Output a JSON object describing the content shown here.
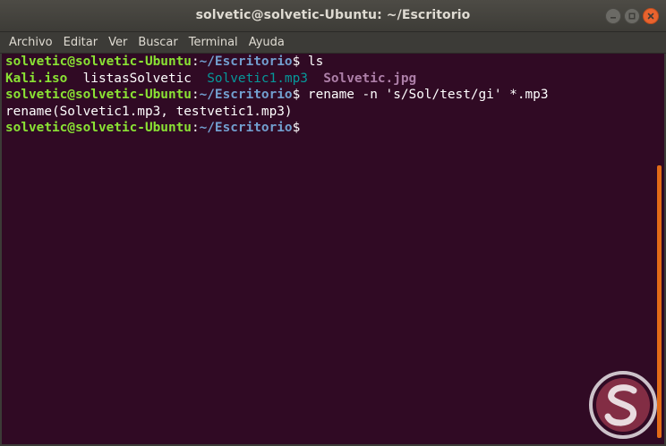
{
  "window": {
    "title": "solvetic@solvetic-Ubuntu: ~/Escritorio",
    "buttons": {
      "minimize_icon": "minimize-icon",
      "maximize_icon": "maximize-icon",
      "close_icon": "close-icon"
    },
    "accent": "#e26b17",
    "close_color": "#e9632e"
  },
  "menubar": {
    "items": [
      "Archivo",
      "Editar",
      "Ver",
      "Buscar",
      "Terminal",
      "Ayuda"
    ]
  },
  "terminal": {
    "background": "#300a24",
    "lines": [
      {
        "kind": "prompt",
        "user": "solvetic@solvetic-Ubuntu",
        "sep": ":",
        "path": "~/Escritorio",
        "dollar": "$",
        "command": " ls"
      },
      {
        "kind": "listing",
        "files": [
          {
            "name": "Kali.iso",
            "type": "kali"
          },
          {
            "name": "listasSolvetic",
            "type": "plain"
          },
          {
            "name": "Solvetic1.mp3",
            "type": "mp3"
          },
          {
            "name": "Solvetic.jpg",
            "type": "jpg"
          }
        ]
      },
      {
        "kind": "prompt",
        "user": "solvetic@solvetic-Ubuntu",
        "sep": ":",
        "path": "~/Escritorio",
        "dollar": "$",
        "command": " rename -n 's/Sol/test/gi' *.mp3"
      },
      {
        "kind": "output",
        "text": "rename(Solvetic1.mp3, testvetic1.mp3)"
      },
      {
        "kind": "prompt",
        "user": "solvetic@solvetic-Ubuntu",
        "sep": ":",
        "path": "~/Escritorio",
        "dollar": "$",
        "command": ""
      }
    ]
  },
  "watermark": {
    "logo_icon": "solvetic-logo-icon"
  }
}
